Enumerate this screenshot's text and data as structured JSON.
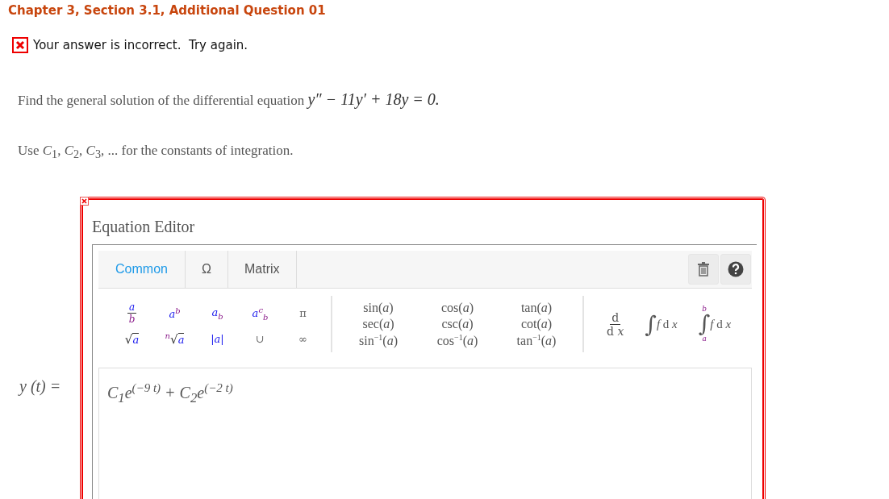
{
  "title": "Chapter 3, Section 3.1, Additional Question 01",
  "feedback": {
    "correct": false,
    "message": "Your answer is incorrect.  Try again."
  },
  "question": "Find the general solution of the differential equation",
  "equation": "y″ − 11y′ + 18y = 0.",
  "instruction": "Use *C*$_{1}$, *C*$_{2}$, *C*$_{3}$, ... for the constants of integration.",
  "editor": {
    "title": "Equation Editor",
    "invalid": true,
    "tabs": [
      {
        "label": "Common",
        "selected": true
      },
      {
        "label": "Ω",
        "selected": false
      },
      {
        "label": "Matrix",
        "selected": false
      }
    ],
    "basic": [
      {
        "kind": "frac",
        "top": "a",
        "bottom": "b"
      },
      {
        "kind": "text",
        "text": "a$^{b}$"
      },
      {
        "kind": "text",
        "text": "a$_{b}$"
      },
      {
        "kind": "text",
        "text": "a$^{c}$$_{b}$"
      },
      {
        "kind": "symbol",
        "text": "π"
      },
      {
        "kind": "root",
        "sign": "√",
        "radicand": "a"
      },
      {
        "kind": "root",
        "index": "n",
        "sign": "√",
        "radicand": "a"
      },
      {
        "kind": "text",
        "text": "|a|"
      },
      {
        "kind": "symbol",
        "text": "∪"
      },
      {
        "kind": "symbol",
        "text": "∞"
      }
    ],
    "trig": [
      "sin(*a*)",
      "cos(*a*)",
      "tan(*a*)",
      "sec(*a*)",
      "csc(*a*)",
      "cot(*a*)",
      "sin$^{−1}$(*a*)",
      "cos$^{−1}$(*a*)",
      "tan$^{−1}$(*a*)"
    ],
    "calculus": [
      {
        "kind": "frac",
        "top": "d",
        "bottom": "d *x*"
      },
      {
        "kind": "integral",
        "sign": "∫",
        "body": "*f* d *x*"
      },
      {
        "kind": "definite",
        "sign": "∫",
        "upper": "b",
        "lower": "a",
        "body": "*f* d *x*"
      }
    ]
  },
  "answer_label": "y (t) =",
  "answer": "C$_{1}$e$^{(−9 t)}$ + C$_{2}$e$^{(−2 t)}$"
}
